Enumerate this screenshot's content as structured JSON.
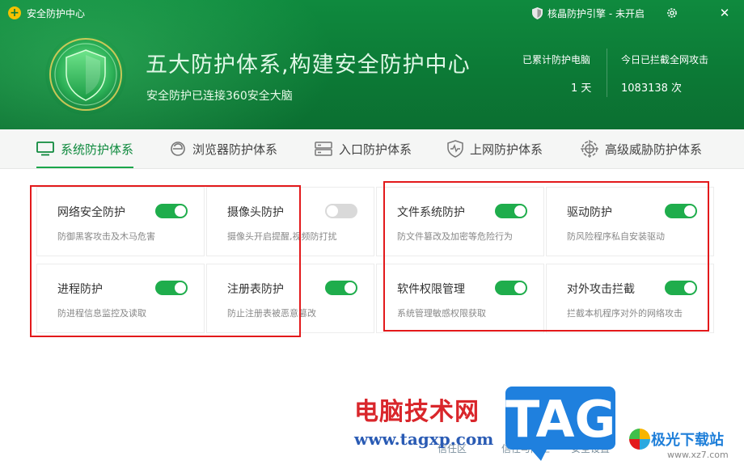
{
  "titlebar": {
    "app_title": "安全防护中心",
    "engine_status": "核晶防护引擎 - 未开启",
    "settings_icon": "gear-icon",
    "close_icon": "close-icon"
  },
  "hero": {
    "title": "五大防护体系,构建安全防护中心",
    "subtitle": "安全防护已连接360安全大脑",
    "stats": [
      {
        "label": "已累计防护电脑",
        "value": "1 天"
      },
      {
        "label": "今日已拦截全网攻击",
        "value": "1083138 次"
      }
    ]
  },
  "tabs": [
    {
      "label": "系统防护体系",
      "icon": "monitor-icon",
      "active": true
    },
    {
      "label": "浏览器防护体系",
      "icon": "browser-icon",
      "active": false
    },
    {
      "label": "入口防护体系",
      "icon": "server-icon",
      "active": false
    },
    {
      "label": "上网防护体系",
      "icon": "shield-pulse-icon",
      "active": false
    },
    {
      "label": "高级威胁防护体系",
      "icon": "radar-icon",
      "active": false
    }
  ],
  "cards": [
    {
      "name": "网络安全防护",
      "desc": "防御黑客攻击及木马危害",
      "enabled": true
    },
    {
      "name": "摄像头防护",
      "desc": "摄像头开启提醒,视频防打扰",
      "enabled": false
    },
    {
      "name": "文件系统防护",
      "desc": "防文件篡改及加密等危险行为",
      "enabled": true
    },
    {
      "name": "驱动防护",
      "desc": "防风险程序私自安装驱动",
      "enabled": true
    },
    {
      "name": "进程防护",
      "desc": "防进程信息监控及读取",
      "enabled": true
    },
    {
      "name": "注册表防护",
      "desc": "防止注册表被恶意篡改",
      "enabled": true
    },
    {
      "name": "软件权限管理",
      "desc": "系统管理敏感权限获取",
      "enabled": true
    },
    {
      "name": "对外攻击拦截",
      "desc": "拦截本机程序对外的网络攻击",
      "enabled": true
    }
  ],
  "footer": {
    "links": [
      "信任区",
      "信任与阻止",
      "安全设置"
    ]
  },
  "watermark": {
    "cn": "电脑技术网",
    "url": "www.tagxp.com",
    "tag": "TAG",
    "site": "极光下载站",
    "site_url": "www.xz7.com"
  },
  "colors": {
    "header_green": "#0c7a36",
    "accent_green": "#1fad4c",
    "toggle_off": "#d9d9d9",
    "highlight_red": "#e3191b"
  }
}
